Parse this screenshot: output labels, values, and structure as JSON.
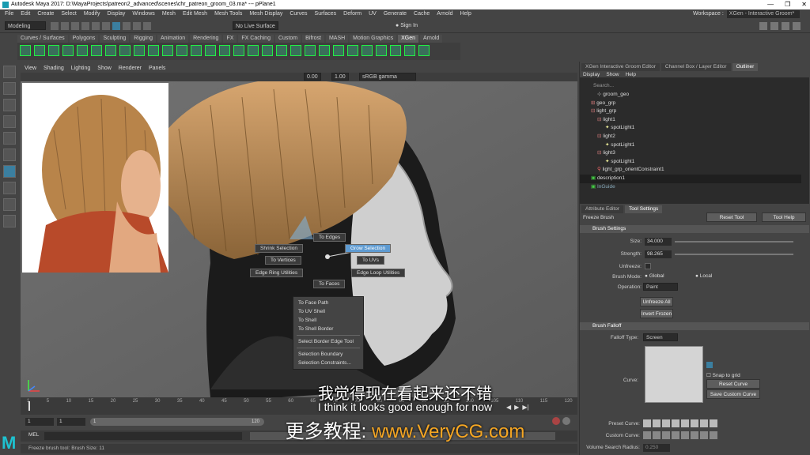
{
  "window": {
    "title": "Autodesk Maya 2017: D:\\MayaProjects\\patreon2_advanced\\scenes\\chr_patreon_groom_03.ma* --- pPlane1",
    "controls": [
      "—",
      "❐",
      "✕"
    ]
  },
  "menubar": {
    "items": [
      "File",
      "Edit",
      "Create",
      "Select",
      "Modify",
      "Display",
      "Windows",
      "Mesh",
      "Edit Mesh",
      "Mesh Tools",
      "Mesh Display",
      "Curves",
      "Surfaces",
      "Deform",
      "UV",
      "Generate",
      "Cache",
      "Arnold",
      "Help"
    ],
    "workspace_label": "Workspace :",
    "workspace_value": "XGen - Interactive Groom*"
  },
  "statusline": {
    "mode": "Modeling",
    "live": "No Live Surface",
    "signin": "Sign In"
  },
  "shelf_tabs": [
    "Curves / Surfaces",
    "Polygons",
    "Sculpting",
    "Rigging",
    "Animation",
    "Rendering",
    "FX",
    "FX Caching",
    "Custom",
    "Bifrost",
    "MASH",
    "Motion Graphics",
    "XGen",
    "Arnold"
  ],
  "shelf_active": "XGen",
  "viewport": {
    "menu": [
      "View",
      "Shading",
      "Lighting",
      "Show",
      "Renderer",
      "Panels"
    ],
    "exposure": "0.00",
    "gamma": "1.00",
    "colorspace": "sRGB gamma"
  },
  "hotbox": {
    "to_edges": "To Edges",
    "shrink": "Shrink Selection",
    "grow": "Grow Selection",
    "to_vertices": "To Vertices",
    "to_uvs": "To UVs",
    "edge_ring": "Edge Ring Utilities",
    "edge_loop": "Edge Loop Utilities",
    "to_faces": "To Faces"
  },
  "context_menu": [
    "To Face Path",
    "To UV Shell",
    "To Shell",
    "To Shell Border",
    "Select Border Edge Tool",
    "Selection Boundary",
    "Selection Constraints..."
  ],
  "timeline": {
    "ticks": [
      "1",
      "5",
      "10",
      "15",
      "20",
      "25",
      "30",
      "35",
      "40",
      "45",
      "50",
      "55",
      "60",
      "65",
      "70",
      "75",
      "80",
      "85",
      "90",
      "95",
      "100",
      "105",
      "110",
      "115",
      "120"
    ],
    "start": "1",
    "start2": "1",
    "current": "1",
    "end": "120"
  },
  "cmdline": {
    "label": "MEL"
  },
  "help_line": "Freeze brush tool: Brush Size: 11",
  "panel": {
    "tabs": [
      "XGen Interactive Groom Editor",
      "Channel Box / Layer Editor",
      "Outliner"
    ],
    "outliner_menu": [
      "Display",
      "Show",
      "Help"
    ],
    "search": "Search...",
    "outliner_rows": [
      {
        "label": "groom_geo",
        "indent": 1
      },
      {
        "label": "geo_grp",
        "indent": 0
      },
      {
        "label": "light_grp",
        "indent": 0
      },
      {
        "label": "light1",
        "indent": 1
      },
      {
        "label": "spotLight1",
        "indent": 2
      },
      {
        "label": "light2",
        "indent": 1
      },
      {
        "label": "spotLight1",
        "indent": 2
      },
      {
        "label": "light3",
        "indent": 1
      },
      {
        "label": "spotLight1",
        "indent": 2
      },
      {
        "label": "light_grp_orientConstraint1",
        "indent": 1
      },
      {
        "label": "description1",
        "indent": 0
      },
      {
        "label": "InGuide",
        "indent": 0
      }
    ],
    "attr_tabs": [
      "Attribute Editor",
      "Tool Settings"
    ],
    "tool_name": "Freeze Brush",
    "reset_tool": "Reset Tool",
    "tool_help": "Tool Help",
    "brush_settings": "Brush Settings",
    "size_label": "Size:",
    "size_value": "34.000",
    "strength_label": "Strength:",
    "strength_value": "98.265",
    "unfreeze_label": "Unfreeze:",
    "brush_mode_label": "Brush Mode:",
    "mode_global": "Global",
    "mode_local": "Local",
    "operation_label": "Operation:",
    "operation_value": "Paint",
    "unfreeze_all": "Unfreeze All",
    "invert_frozen": "Invert Frozen",
    "brush_falloff": "Brush Falloff",
    "falloff_type_label": "Falloff Type:",
    "falloff_type_value": "Screen",
    "curve_label": "Curve:",
    "snap_to_grid": "Snap to grid",
    "reset_curve": "Reset Curve",
    "save_custom": "Save Custom Curve",
    "preset_curve_label": "Preset Curve:",
    "custom_curve_label": "Custom Curve:",
    "volume_search_label": "Volume Search Radius:",
    "volume_search_value": "0.250"
  },
  "subtitles": {
    "zh": "我觉得现在看起来还不错",
    "en": "I think it looks good enough for now",
    "promo_prefix": "更多教程: ",
    "promo_url": "www.VeryCG.com"
  }
}
